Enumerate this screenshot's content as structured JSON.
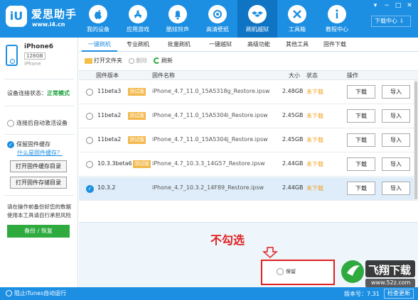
{
  "app": {
    "logo_name": "爱思助手",
    "logo_url": "www.i4.cn"
  },
  "nav": [
    {
      "label": "我的设备",
      "icon": "apple-icon"
    },
    {
      "label": "应用游戏",
      "icon": "app-store-icon"
    },
    {
      "label": "酷炫铃声",
      "icon": "bell-icon"
    },
    {
      "label": "高清壁纸",
      "icon": "wallpaper-icon"
    },
    {
      "label": "刷机越狱",
      "icon": "dropbox-icon",
      "active": true
    },
    {
      "label": "工具箱",
      "icon": "toolbox-icon"
    },
    {
      "label": "教程中心",
      "icon": "info-icon"
    }
  ],
  "window": {
    "download_center": "下载中心"
  },
  "device": {
    "name": "iPhone6",
    "capacity": "128GB",
    "type": "iPhone"
  },
  "left": {
    "conn_label": "设备连接状态：",
    "conn_value": "正常模式",
    "auto_activate": "连接后自动激活设备",
    "keep_cache": "保留固件缓存",
    "what_is_cache": "什么是固件缓存？",
    "open_cache_dir": "打开固件缓存目录",
    "open_store_dir": "打开固件存储目录",
    "risk_text": "请在操作前备份好您的数据使用本工具请自行承担风险",
    "backup_btn": "备份 / 恢复"
  },
  "tabs": [
    "一键刷机",
    "专业刷机",
    "批量刷机",
    "一键越狱",
    "高级功能",
    "其他工具",
    "固件下载"
  ],
  "toolbar": {
    "open_folder": "打开文件夹",
    "delete": "删除",
    "refresh": "刷新"
  },
  "table": {
    "headers": {
      "version": "固件版本",
      "name": "固件名称",
      "size": "大小",
      "status": "状态",
      "action": "操作"
    },
    "rows": [
      {
        "version": "11beta3",
        "badge": "测试版",
        "name": "iPhone_4.7_11.0_15A5318g_Restore.ipsw",
        "size": "2.48GB",
        "status": "未下载",
        "download": "下载",
        "import": "导入",
        "selected": false
      },
      {
        "version": "11beta2",
        "badge": "测试版",
        "name": "iPhone_4.7_11.0_15A5304i_Restore.ipsw",
        "size": "2.45GB",
        "status": "未下载",
        "download": "下载",
        "import": "导入",
        "selected": false
      },
      {
        "version": "11beta2",
        "badge": "测试版",
        "name": "iPhone_4.7_11.0_15A5304j_Restore.ipsw",
        "size": "2.45GB",
        "status": "未下载",
        "download": "下载",
        "import": "导入",
        "selected": false
      },
      {
        "version": "10.3.3beta6",
        "badge": "测试版",
        "name": "iPhone_4.7_10.3.3_14G57_Restore.ipsw",
        "size": "2.44GB",
        "status": "未下载",
        "download": "下载",
        "import": "导入",
        "selected": false
      },
      {
        "version": "10.3.2",
        "badge": "",
        "name": "iPhone_4.7_10.3.2_14F89_Restore.ipsw",
        "size": "2.44GB",
        "status": "未下载",
        "download": "下载",
        "import": "导入",
        "selected": true
      }
    ]
  },
  "annotation": {
    "text": "不勾选",
    "keep_label": "保留"
  },
  "statusbar": {
    "itunes": "阻止iTunes自动运行",
    "version": "版本号：7.31",
    "update": "检查更新"
  },
  "watermark": {
    "title": "飞翔下载",
    "url": "www.52z.com"
  },
  "colors": {
    "brand": "#1c8fe3",
    "nav_active": "#0f74c4",
    "status_pending": "#f0a020",
    "badge": "#f2b84b",
    "backup_green": "#2eaa3e",
    "annotation_red": "#e02020",
    "selected_row": "#deedf9"
  }
}
